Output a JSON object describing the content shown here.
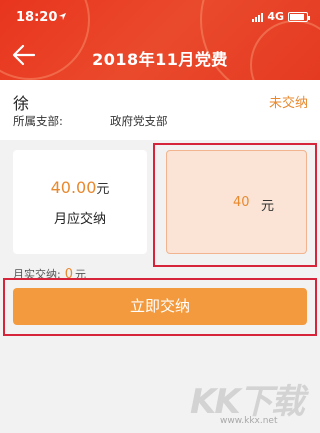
{
  "status_bar": {
    "time": "18:20",
    "network": "4G"
  },
  "header": {
    "title": "2018年11月党费"
  },
  "user": {
    "name": "徐",
    "status": "未交纳",
    "branch_label": "所属支部:",
    "branch_value": "政府党支部"
  },
  "due_card": {
    "amount": "40.00",
    "unit": "元",
    "label": "月应交纳"
  },
  "input_card": {
    "value": "40",
    "unit": "元"
  },
  "paid": {
    "label": "月实交纳:",
    "value": "0",
    "unit": "元"
  },
  "actions": {
    "pay_label": "立即交纳"
  },
  "watermark": {
    "text": "KK下载",
    "url": "www.kkx.net"
  },
  "colors": {
    "header": "#e8351e",
    "accent": "#e8892f",
    "button": "#f39a3e",
    "highlight": "#d6243a"
  },
  "icons": [
    "location-arrow-icon",
    "signal-icon",
    "battery-icon",
    "back-arrow-icon"
  ]
}
